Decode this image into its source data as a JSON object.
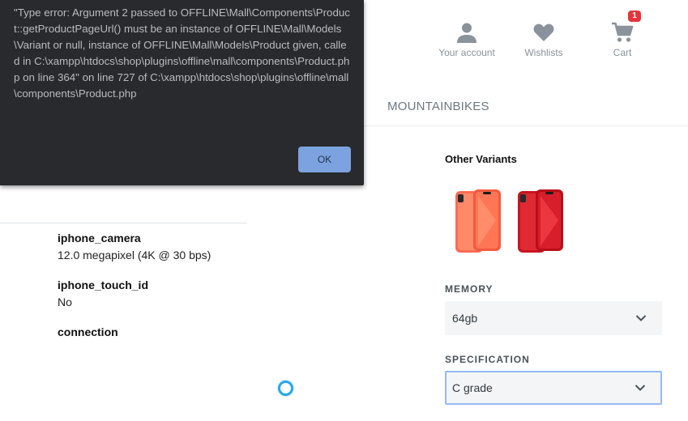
{
  "dialog": {
    "message": "\"Type error: Argument 2 passed to OFFLINE\\Mall\\Components\\Product::getProductPageUrl() must be an instance of OFFLINE\\Mall\\Models\\Variant or null, instance of OFFLINE\\Mall\\Models\\Product given, called in C:\\xampp\\htdocs\\shop\\plugins\\offline\\mall\\components\\Product.php on line 364\" on line 727 of C:\\xampp\\htdocs\\shop\\plugins\\offline\\mall\\components\\Product.php",
    "ok_label": "OK"
  },
  "header": {
    "account_label": "Your account",
    "wishlists_label": "Wishlists",
    "cart_label": "Cart",
    "cart_count": "1",
    "category": "MOUNTAINBIKES"
  },
  "attributes": [
    {
      "name": "iphone_camera",
      "value": "12.0 megapixel (4K @ 30 bps)"
    },
    {
      "name": "iphone_touch_id",
      "value": "No"
    },
    {
      "name": "connection",
      "value": ""
    }
  ],
  "variants": {
    "title": "Other Variants",
    "items": [
      {
        "name": "coral-iphone",
        "color": "#ff6b52"
      },
      {
        "name": "red-iphone",
        "color": "#d61f2c"
      }
    ]
  },
  "memory": {
    "label": "MEMORY",
    "selected": "64gb"
  },
  "specification": {
    "label": "SPECIFICATION",
    "selected": "C grade"
  },
  "colors": {
    "dialog_bg": "#292a2d",
    "ok_button": "#7ca3e0",
    "badge": "#e3353b",
    "icon": "#8a929b",
    "spinner": "#2aa6e8"
  }
}
